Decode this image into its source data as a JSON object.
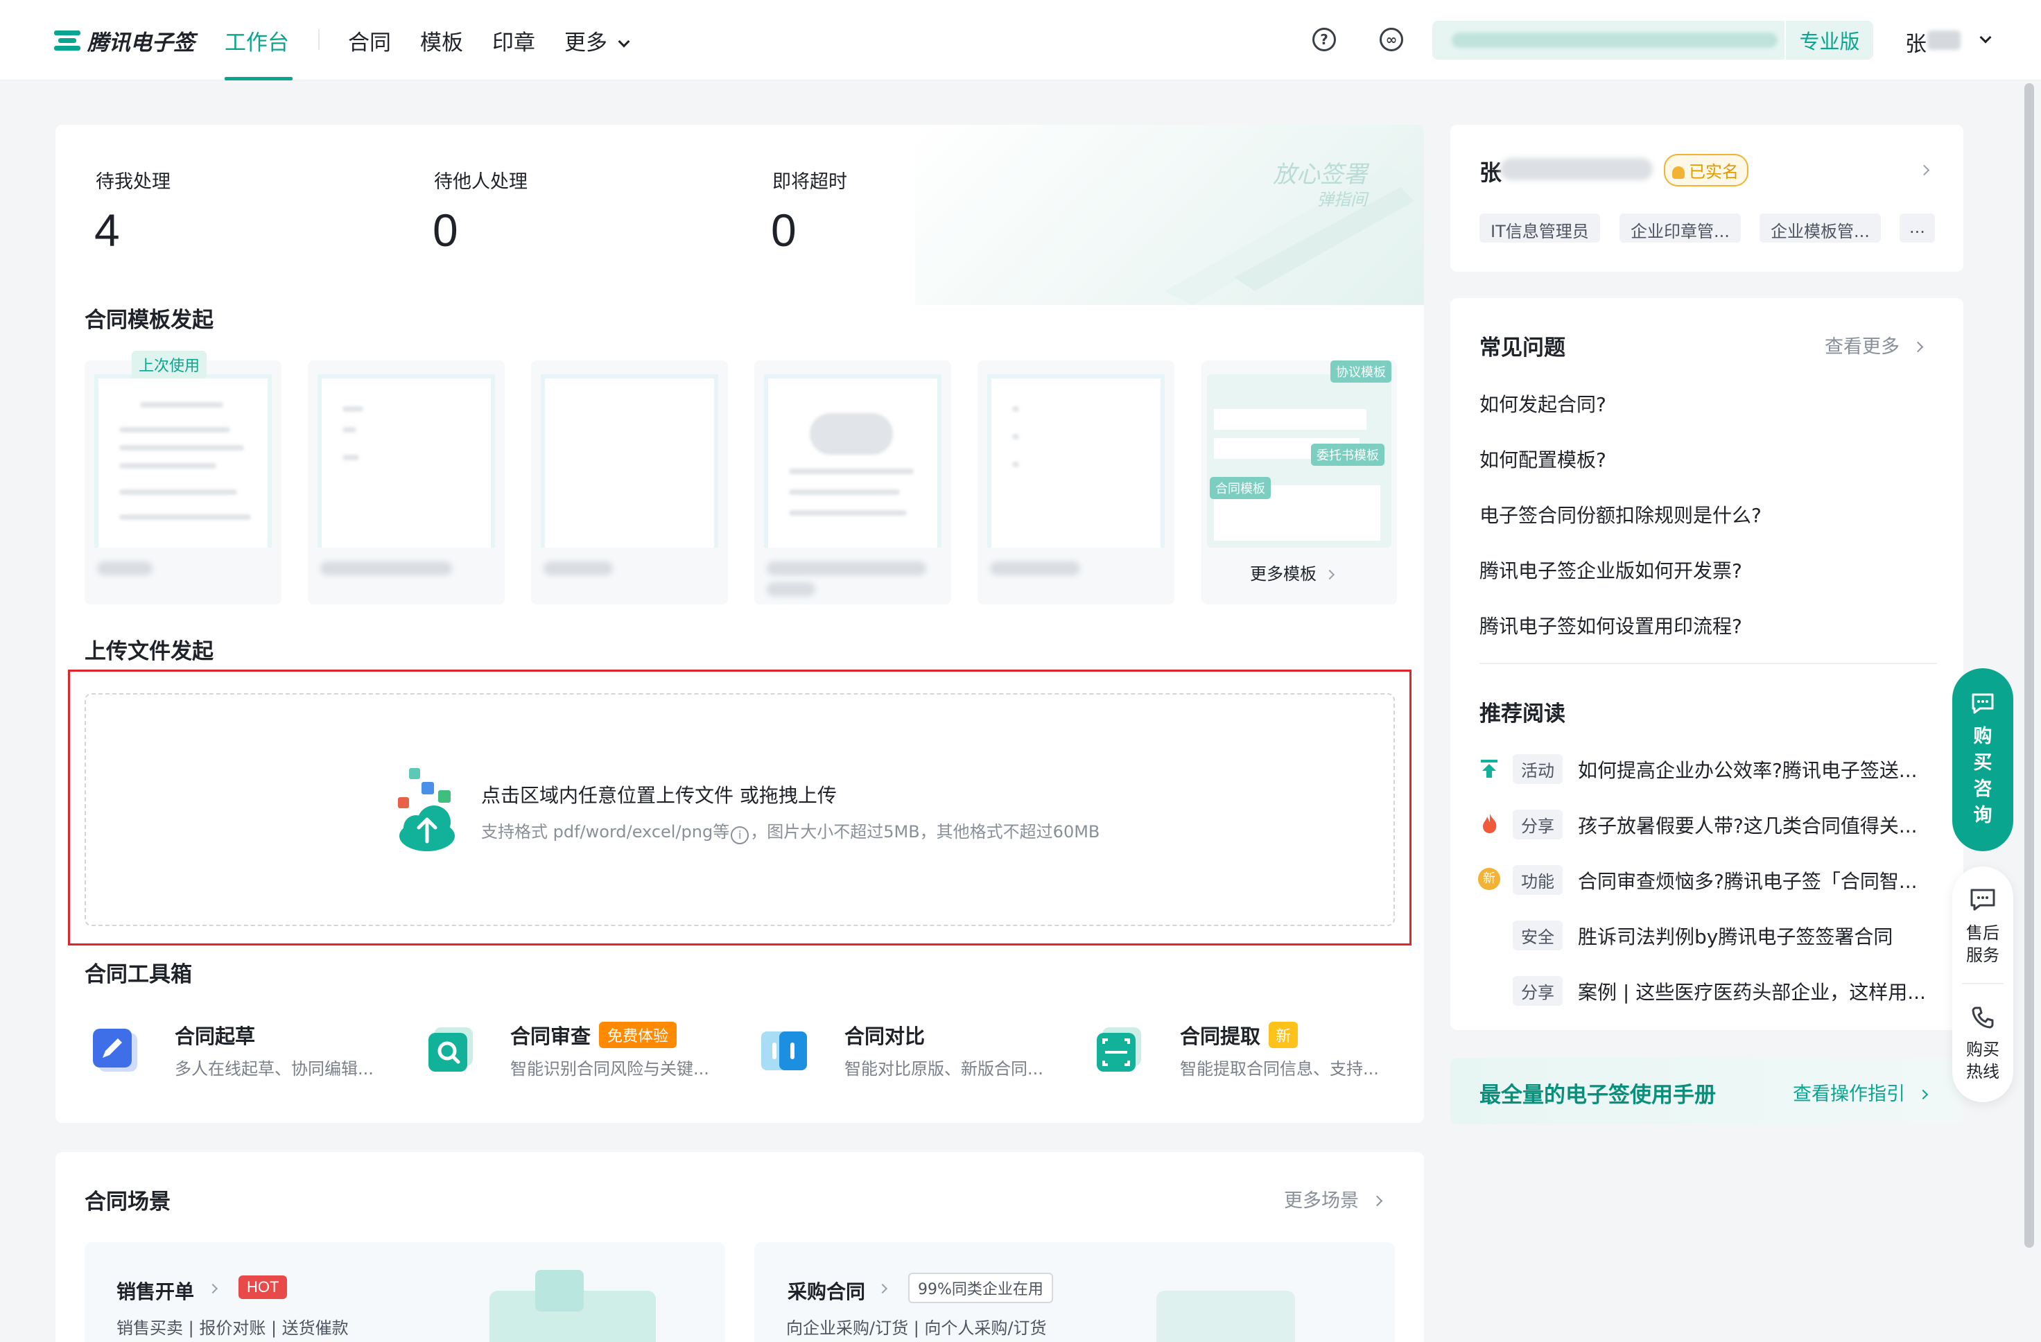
{
  "nav": {
    "logo_text": "腾讯电子签",
    "items": [
      "工作台",
      "合同",
      "模板",
      "印章",
      "更多"
    ],
    "edition": "专业版",
    "user_initial": "张"
  },
  "stats": [
    {
      "label": "待我处理",
      "value": "4"
    },
    {
      "label": "待他人处理",
      "value": "0"
    },
    {
      "label": "即将超时",
      "value": "0"
    }
  ],
  "watermark": {
    "line1": "放心签署",
    "line2": "弹指间"
  },
  "templates": {
    "title": "合同模板发起",
    "last_used_tag": "上次使用",
    "more_label": "更多模板",
    "preview_tags": [
      "协议模板",
      "委托书模板",
      "合同模板"
    ]
  },
  "upload": {
    "title": "上传文件发起",
    "main_text": "点击区域内任意位置上传文件 或拖拽上传",
    "hint_text": "支持格式 pdf/word/excel/png等",
    "hint_text2": "，图片大小不超过5MB，其他格式不超过60MB"
  },
  "toolbox": {
    "title": "合同工具箱",
    "tools": [
      {
        "title": "合同起草",
        "desc": "多人在线起草、协同编辑...",
        "badge": ""
      },
      {
        "title": "合同审查",
        "desc": "智能识别合同风险与关键...",
        "badge": "免费体验"
      },
      {
        "title": "合同对比",
        "desc": "智能对比原版、新版合同...",
        "badge": ""
      },
      {
        "title": "合同提取",
        "desc": "智能提取合同信息、支持...",
        "badge": "新"
      }
    ]
  },
  "scenes": {
    "title": "合同场景",
    "more_label": "更多场景",
    "items": [
      {
        "title": "销售开单",
        "badge": "HOT",
        "desc": "销售买卖 | 报价对账 | 送货催款"
      },
      {
        "title": "采购合同",
        "badge": "99%同类企业在用",
        "desc": "向企业采购/订货 | 向个人采购/订货"
      }
    ]
  },
  "profile": {
    "name": "张",
    "verified": "已实名",
    "roles": [
      "IT信息管理员",
      "企业印章管...",
      "企业模板管...",
      "..."
    ]
  },
  "faq": {
    "title": "常见问题",
    "more_label": "查看更多",
    "items": [
      "如何发起合同?",
      "如何配置模板?",
      "电子签合同份额扣除规则是什么?",
      "腾讯电子签企业版如何开发票?",
      "腾讯电子签如何设置用印流程?"
    ]
  },
  "reading": {
    "title": "推荐阅读",
    "items": [
      {
        "icon": "arrow-up-icon",
        "tag": "活动",
        "text": "如何提高企业办公效率?腾讯电子签送..."
      },
      {
        "icon": "fire-icon",
        "tag": "分享",
        "text": "孩子放暑假要人带?这几类合同值得关..."
      },
      {
        "icon": "new-icon",
        "icon_text": "新",
        "tag": "功能",
        "text": "合同审查烦恼多?腾讯电子签「合同智..."
      },
      {
        "icon": "",
        "tag": "安全",
        "text": "胜诉司法判例by腾讯电子签签署合同"
      },
      {
        "icon": "",
        "tag": "分享",
        "text": "案例 | 这些医疗医药头部企业，这样用..."
      }
    ]
  },
  "manual": {
    "title": "最全量的电子签使用手册",
    "link": "查看操作指引"
  },
  "float": {
    "buy": [
      "购",
      "买",
      "咨",
      "询"
    ],
    "service": [
      "售后",
      "服务"
    ],
    "hotline": [
      "购买",
      "热线"
    ]
  },
  "colors": {
    "brand": "#0aa58f",
    "highlight_frame": "#e0262c",
    "hot": "#e84a4a",
    "free": "#ff8a00"
  }
}
